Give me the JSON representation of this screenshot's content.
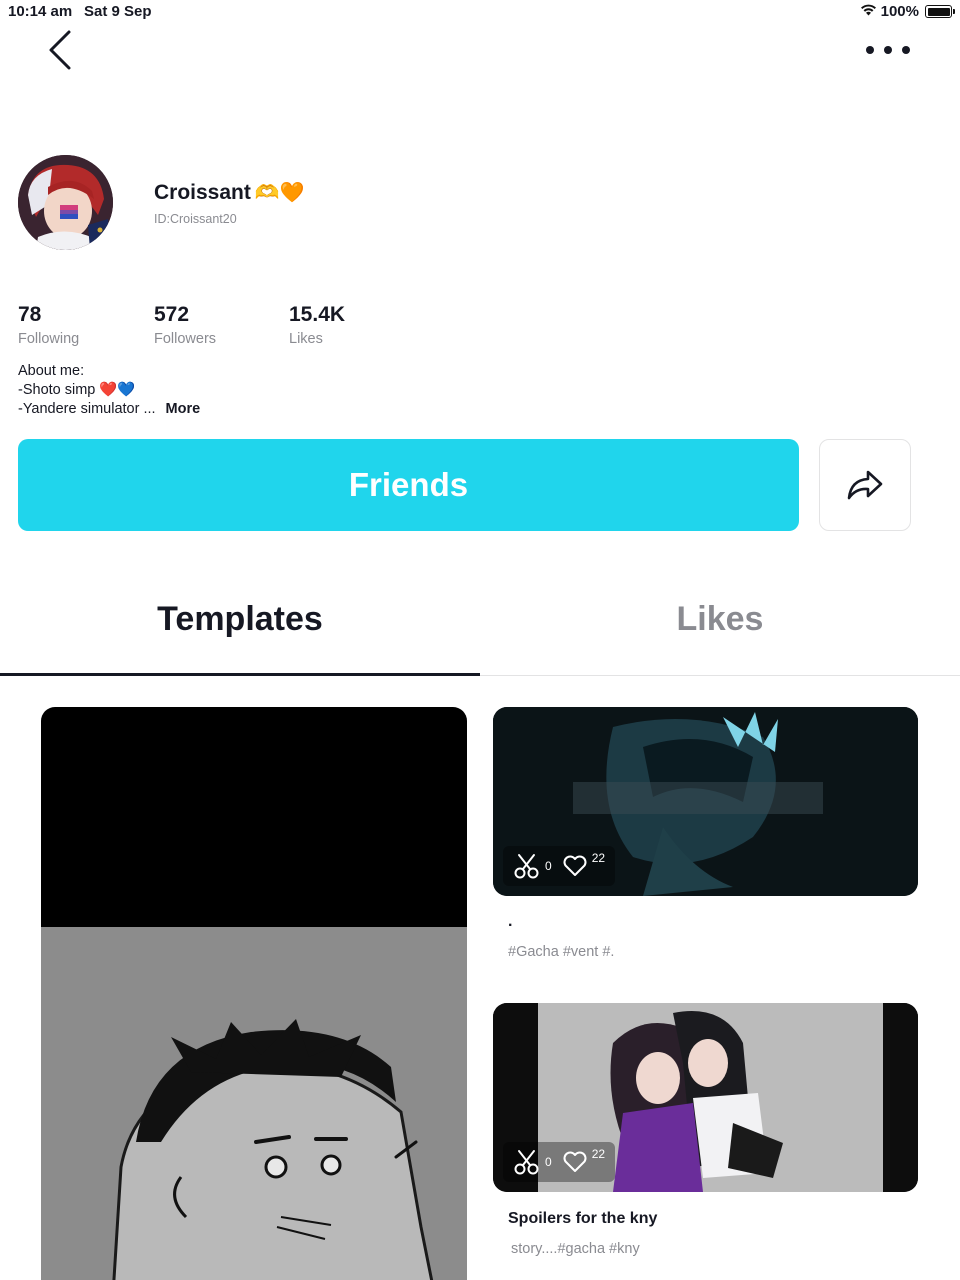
{
  "status_bar": {
    "time": "10:14 am",
    "date": "Sat 9 Sep",
    "battery": "100%"
  },
  "profile": {
    "name": "Croissant",
    "name_emoji": "🫶🧡",
    "user_id": "ID:Croissant20",
    "stats": [
      {
        "value": "78",
        "label": "Following"
      },
      {
        "value": "572",
        "label": "Followers"
      },
      {
        "value": "15.4K",
        "label": "Likes"
      }
    ],
    "bio": {
      "line1": "About me:",
      "line2": "-Shoto simp",
      "line2_emoji": "❤️💙",
      "line3": "-Yandere simulator ...",
      "more": "More"
    }
  },
  "actions": {
    "friends_label": "Friends"
  },
  "tabs": [
    {
      "label": "Templates",
      "active": true
    },
    {
      "label": "Likes",
      "active": false
    }
  ],
  "templates": [
    {
      "title": "",
      "tags": "",
      "uses": "",
      "likes": ""
    },
    {
      "title": ".",
      "tags": "#Gacha #vent #.",
      "uses": "0",
      "likes": "22"
    },
    {
      "title": "Spoilers for the kny",
      "tags": "story....#gacha #kny",
      "uses": "0",
      "likes": "22"
    }
  ],
  "colors": {
    "accent": "#20d5ec",
    "text": "#161823",
    "muted": "#8a8b91"
  }
}
